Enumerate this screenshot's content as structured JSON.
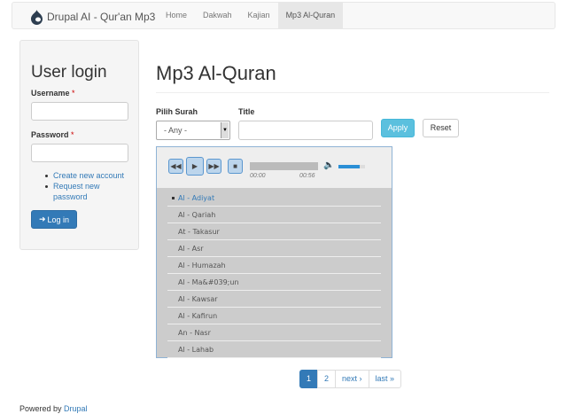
{
  "navbar": {
    "brand": "Drupal AI - Qur'an Mp3",
    "items": [
      {
        "label": "Home"
      },
      {
        "label": "Dakwah"
      },
      {
        "label": "Kajian"
      },
      {
        "label": "Mp3 Al-Quran"
      }
    ]
  },
  "login": {
    "title": "User login",
    "username_label": "Username",
    "password_label": "Password",
    "required_mark": "*",
    "links": [
      "Create new account",
      "Request new password"
    ],
    "button": "Log in"
  },
  "main": {
    "title": "Mp3 Al-Quran",
    "filter_surah_label": "Pilih Surah",
    "filter_surah_value": "- Any -",
    "filter_title_label": "Title",
    "filter_title_value": "",
    "apply_label": "Apply",
    "reset_label": "Reset"
  },
  "player": {
    "current_time": "00:00",
    "duration": "00:56",
    "progress": 0,
    "volume": 0.8,
    "playlist": [
      "Al - Adiyat",
      "Al - Qariah",
      "At - Takasur",
      "Al - Asr",
      "Al - Humazah",
      "Al - Ma&#039;un",
      "Al - Kawsar",
      "Al - Kafirun",
      "An - Nasr",
      "Al - Lahab"
    ],
    "current_index": 0
  },
  "pager": {
    "pages": [
      "1",
      "2"
    ],
    "current": "1",
    "next": "next ›",
    "last": "last »"
  },
  "footer": {
    "prefix": "Powered by",
    "link": "Drupal"
  },
  "colors": {
    "link": "#337ab7",
    "primary": "#337ab7",
    "info": "#5bc0de"
  }
}
